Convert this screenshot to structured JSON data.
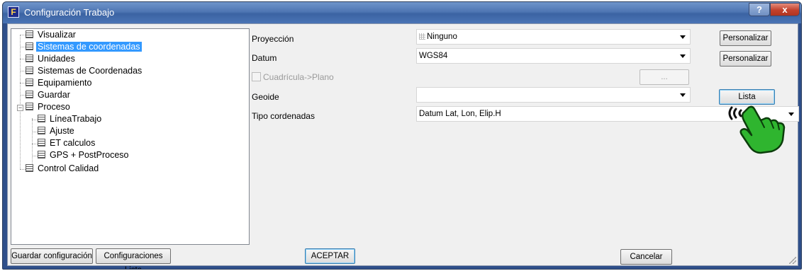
{
  "window": {
    "title": "Configuración Trabajo",
    "help_label": "?",
    "close_label": "x",
    "app_icon_glyph": "F"
  },
  "tree": {
    "items": [
      {
        "label": "Visualizar"
      },
      {
        "label": "Sistemas de coordenadas",
        "selected": true
      },
      {
        "label": "Unidades"
      },
      {
        "label": "Sistemas de Coordenadas"
      },
      {
        "label": "Equipamiento"
      },
      {
        "label": "Guardar"
      },
      {
        "label": "Proceso",
        "expanded": true
      },
      {
        "label": "LíneaTrabajo"
      },
      {
        "label": "Ajuste"
      },
      {
        "label": "ET calculos"
      },
      {
        "label": "GPS + PostProceso"
      },
      {
        "label": "Control Calidad"
      }
    ],
    "expander_symbol": "−"
  },
  "form": {
    "proyeccion": {
      "label": "Proyección",
      "value": "Ninguno",
      "button": "Personalizar"
    },
    "datum": {
      "label": "Datum",
      "value": "WGS84",
      "button": "Personalizar"
    },
    "cuadricula": {
      "label": "Cuadrícula->Plano",
      "button": "..."
    },
    "geoide": {
      "label": "Geoide",
      "value": "",
      "button": "Lista Geoides..."
    },
    "tipo": {
      "label": "Tipo cordenadas",
      "value": "Datum Lat, Lon, Elip.H"
    }
  },
  "footer": {
    "save_config": "Guardar configuración",
    "config_list": "Configuraciones Lista",
    "accept": "ACEPTAR",
    "cancel": "Cancelar"
  },
  "colors": {
    "selection": "#3399ff",
    "titlebar": "#4f76b3",
    "hand": "#2fb52f"
  }
}
